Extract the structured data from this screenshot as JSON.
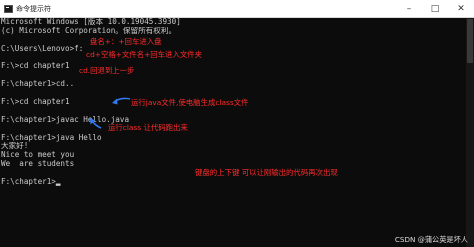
{
  "window": {
    "title": "命令提示符",
    "controls": {
      "minimize": "–",
      "maximize": "□",
      "close": "✕"
    }
  },
  "console": {
    "lines": [
      "Microsoft Windows [版本 10.0.19045.3930]",
      "(c) Microsoft Corporation。保留所有权利。",
      "",
      "C:\\Users\\Lenovo>f:",
      "",
      "F:\\>cd chapter1",
      "",
      "F:\\chapter1>cd..",
      "",
      "F:\\>cd chapter1",
      "",
      "F:\\chapter1>javac Hello.java",
      "",
      "F:\\chapter1>java Hello",
      "大家好!",
      "Nice to meet you",
      "We  are students",
      "",
      "F:\\chapter1>"
    ],
    "cursor": "▂"
  },
  "annotations": {
    "drive_switch": "盘名+：+回车进入盘",
    "cd_folder": "cd+空格+文件名+回车进入文件夹",
    "cd_back": "cd.回退到上一步",
    "compile": "运行java文件,使电脑生成class文件",
    "run_class": "运行class 让代码跑出来",
    "history_keys": "键盘的上下键 可以让刚输出的代码再次出现"
  },
  "watermark": "CSDN @蒲公英是坏人",
  "colors": {
    "console_bg": "#0c0c0c",
    "console_text": "#cccccc",
    "annotation": "#ff2b2b",
    "arrow": "#2f7cf6"
  }
}
